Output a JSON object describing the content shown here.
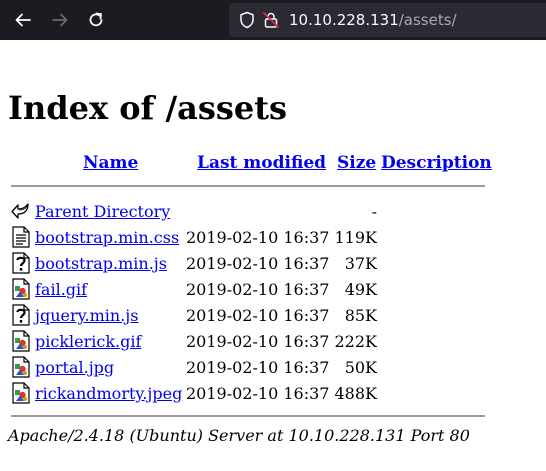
{
  "browser": {
    "url_host": "10.10.228.131",
    "url_path": "/assets/"
  },
  "page": {
    "title": "Index of /assets",
    "columns": {
      "name": "Name",
      "last_modified": "Last modified",
      "size": "Size",
      "description": "Description"
    },
    "rows": [
      {
        "name": "Parent Directory",
        "date": "",
        "size": "-",
        "icon": "back-icon"
      },
      {
        "name": "bootstrap.min.css",
        "date": "2019-02-10 16:37",
        "size": "119K",
        "icon": "text-file-icon"
      },
      {
        "name": "bootstrap.min.js",
        "date": "2019-02-10 16:37",
        "size": "37K",
        "icon": "unknown-file-icon"
      },
      {
        "name": "fail.gif",
        "date": "2019-02-10 16:37",
        "size": "49K",
        "icon": "image-file-icon"
      },
      {
        "name": "jquery.min.js",
        "date": "2019-02-10 16:37",
        "size": "85K",
        "icon": "unknown-file-icon"
      },
      {
        "name": "picklerick.gif",
        "date": "2019-02-10 16:37",
        "size": "222K",
        "icon": "image-file-icon"
      },
      {
        "name": "portal.jpg",
        "date": "2019-02-10 16:37",
        "size": "50K",
        "icon": "image-file-icon"
      },
      {
        "name": "rickandmorty.jpeg",
        "date": "2019-02-10 16:37",
        "size": "488K",
        "icon": "image-file-icon"
      }
    ],
    "footer": "Apache/2.4.18 (Ubuntu) Server at 10.10.228.131 Port 80"
  }
}
